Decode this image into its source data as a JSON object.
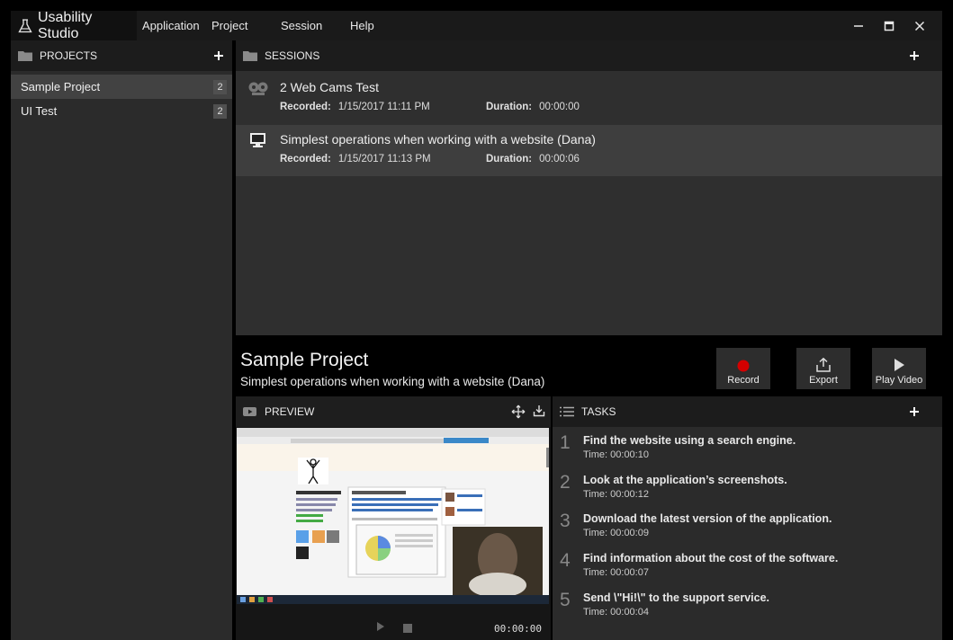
{
  "app": {
    "title": "Usability Studio"
  },
  "menu": [
    {
      "label": "Application"
    },
    {
      "label": "Project"
    },
    {
      "label": "Session"
    },
    {
      "label": "Help"
    }
  ],
  "window_controls": {
    "minimize": "−",
    "maximize": "□",
    "close": "✕"
  },
  "projects": {
    "header": "PROJECTS",
    "items": [
      {
        "name": "Sample Project",
        "count": "2"
      },
      {
        "name": "UI Test",
        "count": "2"
      }
    ]
  },
  "sessions": {
    "header": "SESSIONS",
    "items": [
      {
        "title": "2 Web Cams Test",
        "recorded_label": "Recorded:",
        "recorded": "1/15/2017 11:11 PM",
        "duration_label": "Duration:",
        "duration": "00:00:00",
        "icon": "webcam-icon"
      },
      {
        "title": "Simplest operations when working with a website (Dana)",
        "recorded_label": "Recorded:",
        "recorded": "1/15/2017 11:13 PM",
        "duration_label": "Duration:",
        "duration": "00:00:06",
        "icon": "monitor-icon"
      }
    ]
  },
  "info": {
    "project_title": "Sample Project",
    "session_subtitle": "Simplest operations when working with a website (Dana)"
  },
  "toolbar": {
    "record_label": "Record",
    "export_label": "Export",
    "play_label": "Play Video",
    "record_color": "#d40000"
  },
  "preview": {
    "header": "PREVIEW",
    "time": "00:00:00"
  },
  "tasks": {
    "header": "TASKS",
    "items": [
      {
        "num": "1",
        "name": "Find the website using a search engine.",
        "time": "Time: 00:00:10"
      },
      {
        "num": "2",
        "name": "Look at the application’s screenshots.",
        "time": "Time: 00:00:12"
      },
      {
        "num": "3",
        "name": "Download the latest version of the application.",
        "time": "Time: 00:00:09"
      },
      {
        "num": "4",
        "name": "Find information about the cost of the software.",
        "time": "Time: 00:00:07"
      },
      {
        "num": "5",
        "name": "Send \\\"Hi!\\\" to the support service.",
        "time": "Time: 00:00:04"
      }
    ]
  }
}
